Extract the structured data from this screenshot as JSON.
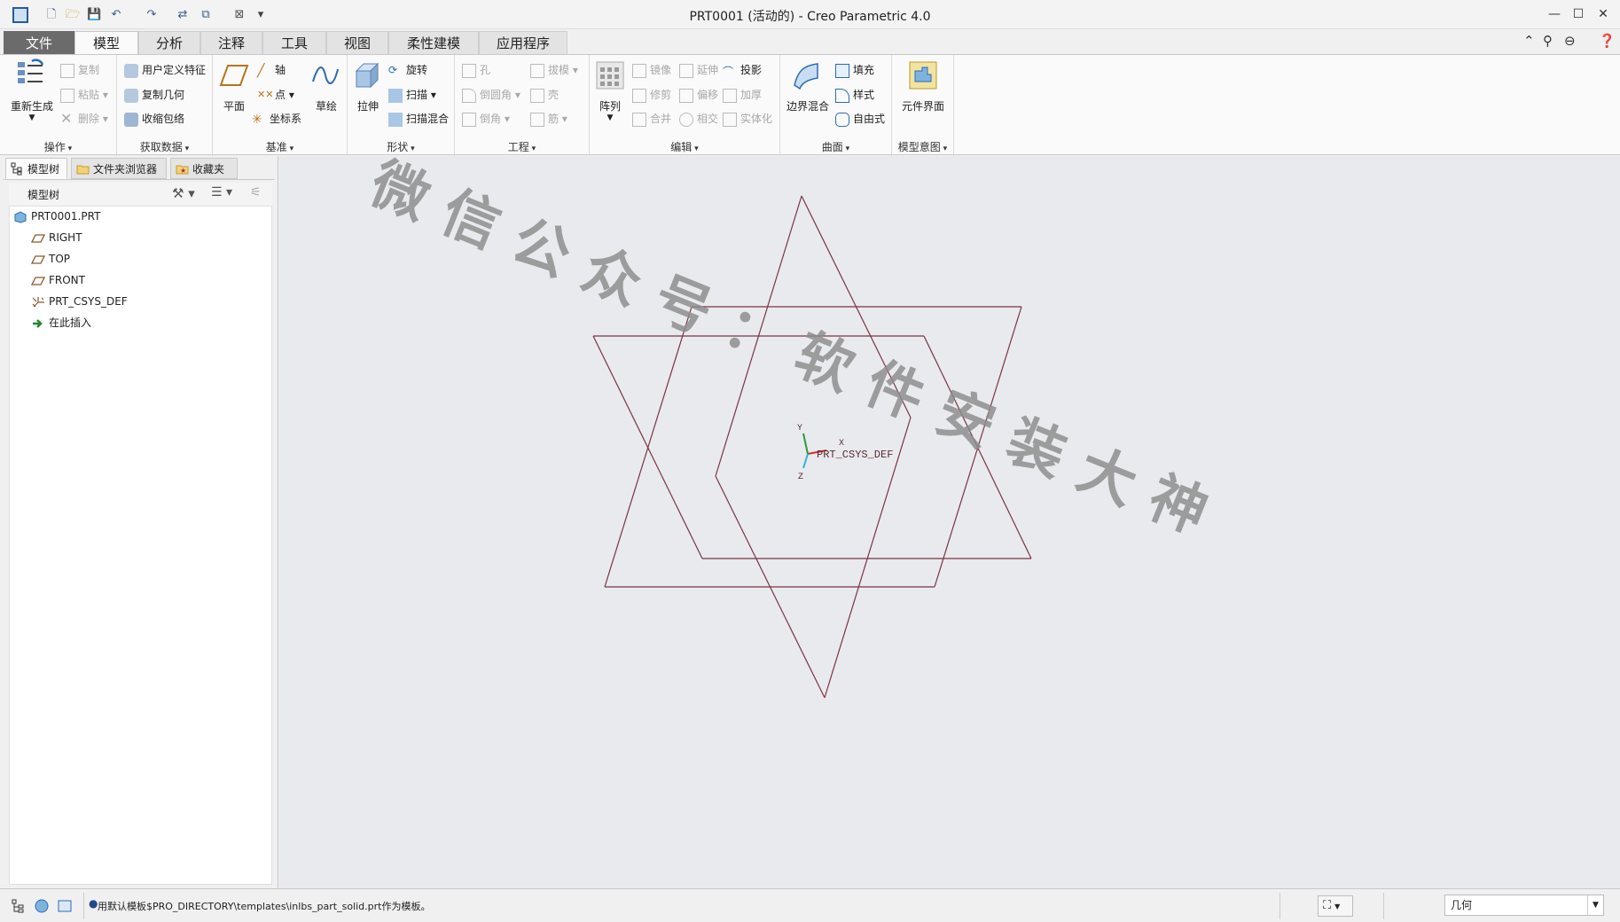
{
  "window": {
    "title": "PRT0001 (活动的) - Creo Parametric 4.0"
  },
  "tabs": [
    {
      "label": "文件"
    },
    {
      "label": "模型"
    },
    {
      "label": "分析"
    },
    {
      "label": "注释"
    },
    {
      "label": "工具"
    },
    {
      "label": "视图"
    },
    {
      "label": "柔性建模"
    },
    {
      "label": "应用程序"
    }
  ],
  "ribbon": {
    "ops": {
      "label": "操作",
      "regen": "重新生成",
      "copy": "复制",
      "paste": "粘贴",
      "delete": "删除"
    },
    "getdata": {
      "label": "获取数据",
      "udf": "用户定义特征",
      "copygeom": "复制几何",
      "shrinkwrap": "收缩包络"
    },
    "datum": {
      "label": "基准",
      "plane": "平面",
      "axis": "轴",
      "point": "点",
      "csys": "坐标系",
      "sketch": "草绘"
    },
    "shapes": {
      "label": "形状",
      "extrude": "拉伸",
      "revolve": "旋转",
      "sweep": "扫描",
      "sweepblend": "扫描混合"
    },
    "engineering": {
      "label": "工程",
      "hole": "孔",
      "round": "倒圆角",
      "chamfer": "倒角",
      "draft": "拔模",
      "shell": "壳",
      "rib": "筋"
    },
    "editing": {
      "label": "编辑",
      "pattern": "阵列",
      "mirror": "镜像",
      "trim": "修剪",
      "merge": "合并",
      "extend": "延伸",
      "offset": "偏移",
      "intersect": "相交",
      "project": "投影",
      "thicken": "加厚",
      "solidify": "实体化"
    },
    "surfaces": {
      "label": "曲面",
      "boundary": "边界混合",
      "fill": "填充",
      "style": "样式",
      "freestyle": "自由式"
    },
    "intent": {
      "label": "模型意图",
      "component_interface": "元件界面"
    }
  },
  "left_panel": {
    "tabs": [
      {
        "label": "模型树"
      },
      {
        "label": "文件夹浏览器"
      },
      {
        "label": "收藏夹"
      }
    ],
    "header": "模型树",
    "tree": [
      {
        "label": "PRT0001.PRT",
        "icon": "part-icon"
      },
      {
        "label": "RIGHT",
        "icon": "datum-plane-icon"
      },
      {
        "label": "TOP",
        "icon": "datum-plane-icon"
      },
      {
        "label": "FRONT",
        "icon": "datum-plane-icon"
      },
      {
        "label": "PRT_CSYS_DEF",
        "icon": "csys-icon"
      },
      {
        "label": "在此插入",
        "icon": "insert-arrow-icon"
      }
    ]
  },
  "graphics": {
    "csys_label": "PRT_CSYS_DEF",
    "axis_x": "X",
    "axis_y": "Y",
    "axis_z": "Z",
    "watermark": "微信公众号：软件安装大神"
  },
  "statusbar": {
    "message": "用默认模板$PRO_DIRECTORY\\templates\\inlbs_part_solid.prt作为模板。",
    "filter_value": "几何"
  },
  "colors": {
    "datum_plane": "#7a3442",
    "graphics_bg": "#e8eaee",
    "file_tab": "#6b6b6b",
    "watermark": "#8c8c8c"
  }
}
